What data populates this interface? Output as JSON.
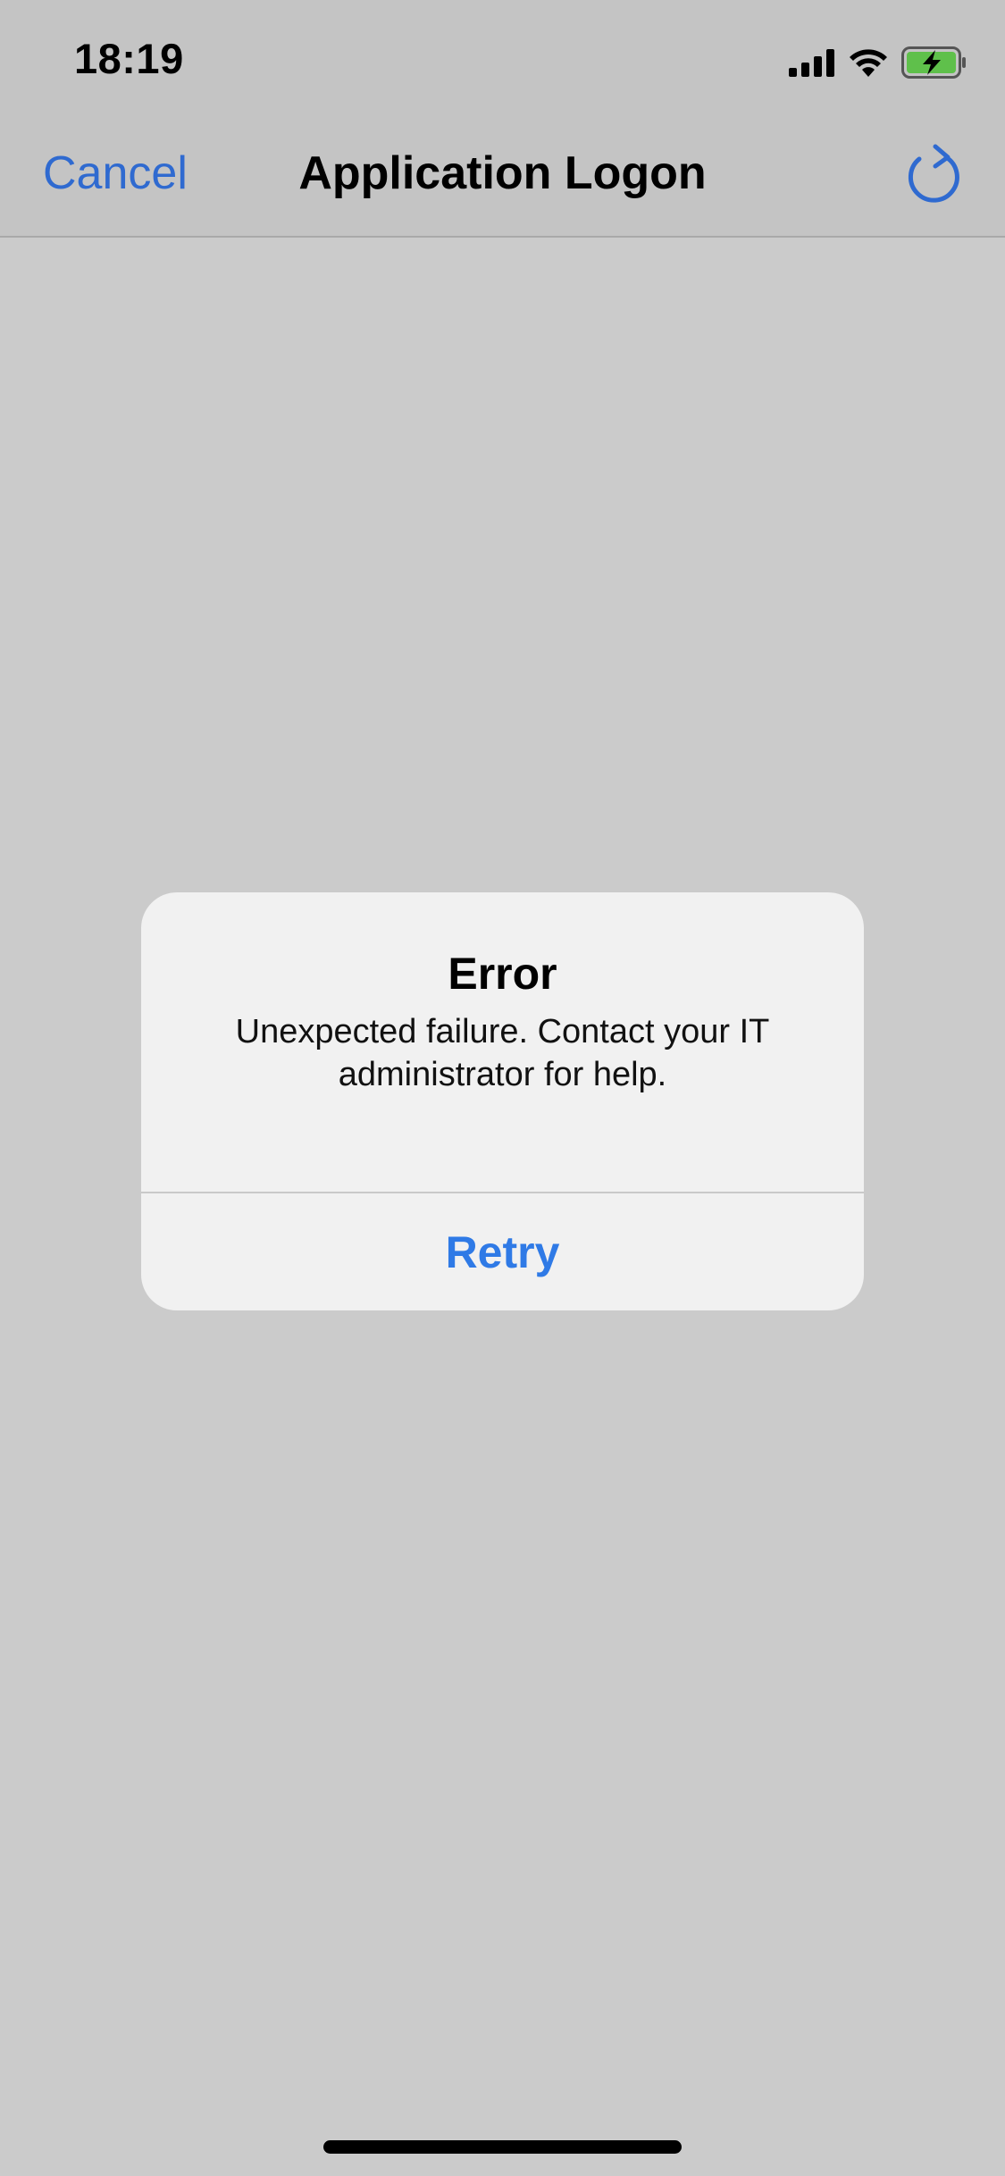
{
  "status_bar": {
    "time": "18:19",
    "icons": [
      "cellular-signal-icon",
      "wifi-icon",
      "battery-charging-icon"
    ]
  },
  "nav": {
    "cancel_label": "Cancel",
    "title": "Application Logon",
    "refresh_icon": "refresh-icon"
  },
  "alert": {
    "title": "Error",
    "message": "Unexpected failure. Contact your IT administrator for help.",
    "retry_label": "Retry"
  },
  "colors": {
    "accent": "#2f6ad0",
    "alert_button": "#2f7ae6",
    "battery_fill": "#5fc04b",
    "background": "#cbcbcb"
  }
}
